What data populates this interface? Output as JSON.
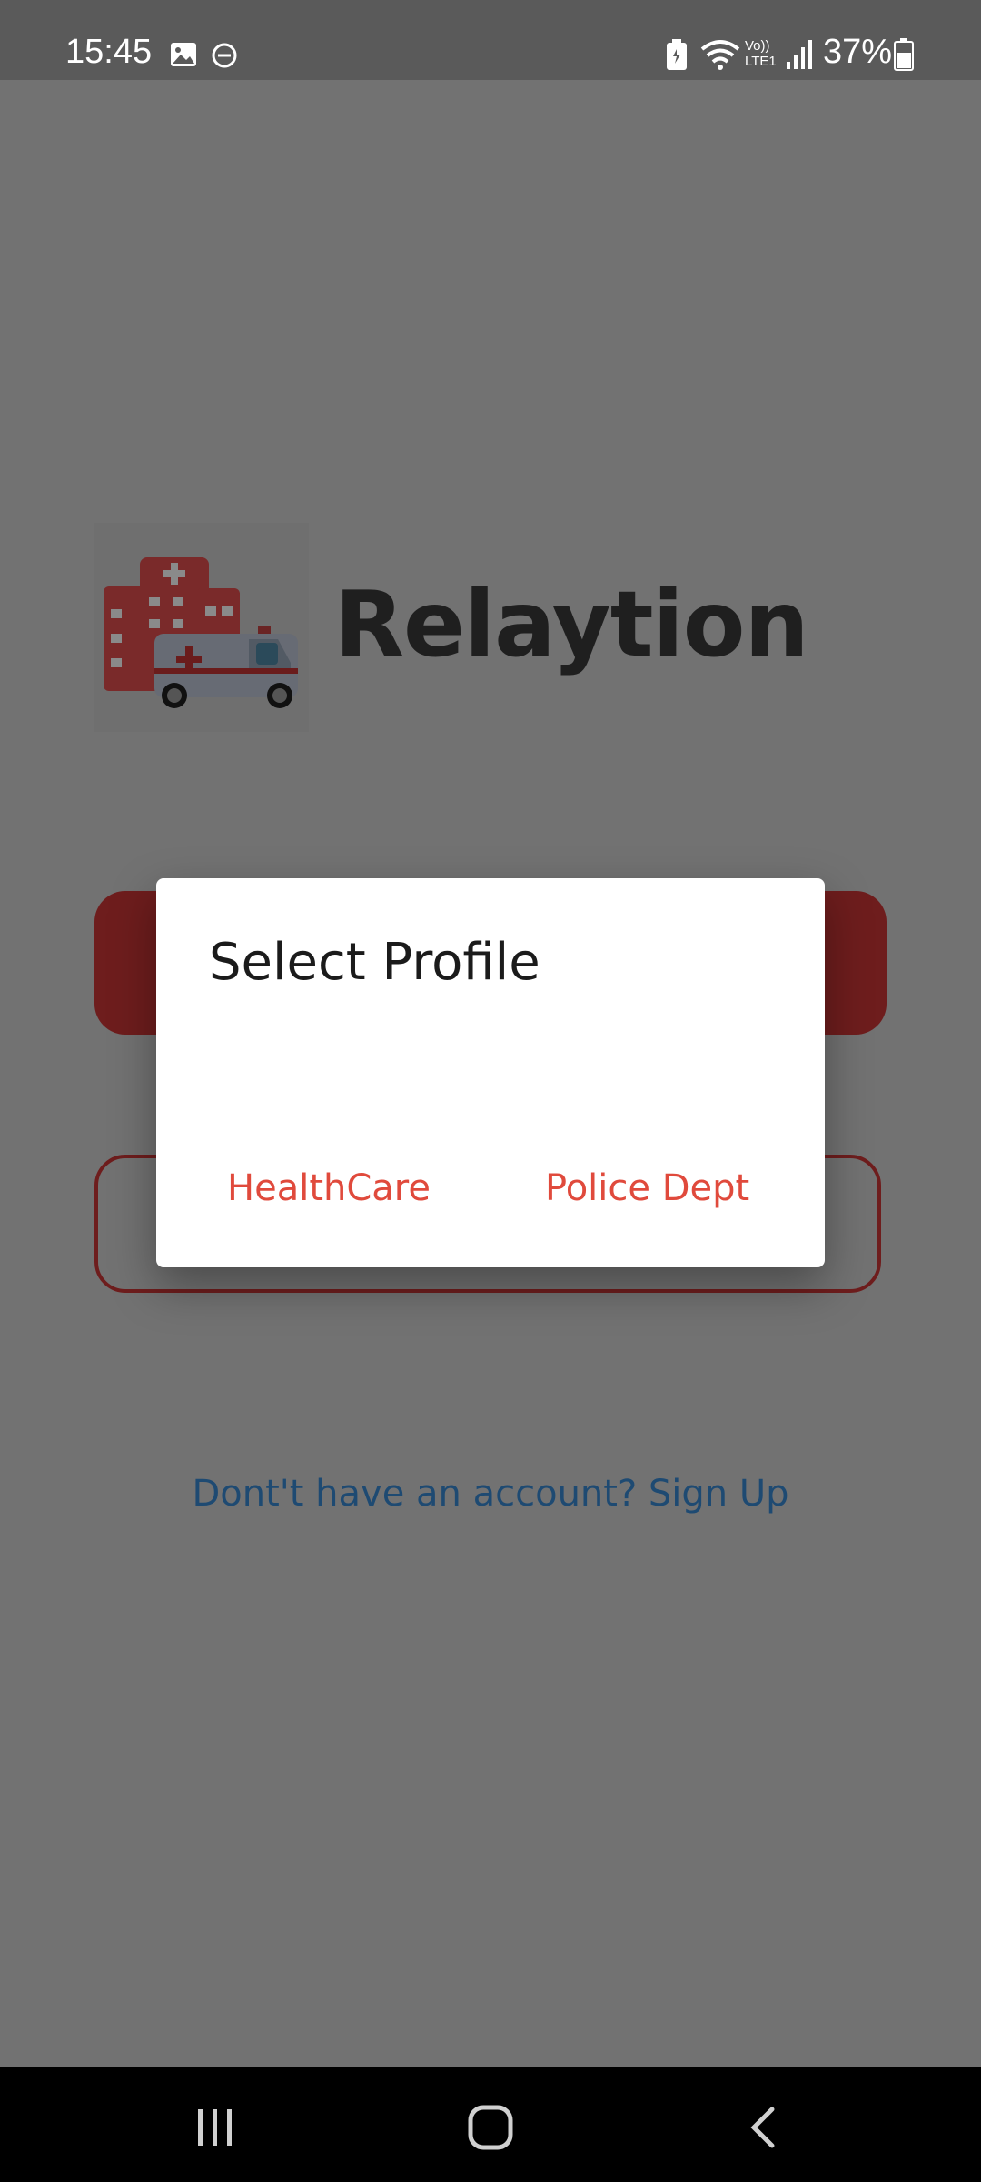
{
  "status_bar": {
    "time": "15:45",
    "battery_percent": "37%",
    "icons": [
      "image-icon",
      "dnd-icon",
      "battery-saver-icon",
      "wifi-icon",
      "volte-icon",
      "signal-icon",
      "battery-icon"
    ],
    "network_label_top": "Vo))",
    "network_label_bottom": "LTE1"
  },
  "app": {
    "name": "Relaytion",
    "signup_text": "Dont't have an account? Sign Up"
  },
  "dialog": {
    "title": "Select Profile",
    "options": [
      {
        "label": "HealthCare"
      },
      {
        "label": "Police Dept"
      }
    ]
  },
  "nav_bar": {
    "icons": [
      "recents-icon",
      "home-icon",
      "back-icon"
    ]
  },
  "colors": {
    "scrim_background": "#727272",
    "brand_red": "#e04a3c",
    "primary_button_dimmed": "#6e1d1d",
    "link_blue_dimmed": "#1e4a72"
  }
}
